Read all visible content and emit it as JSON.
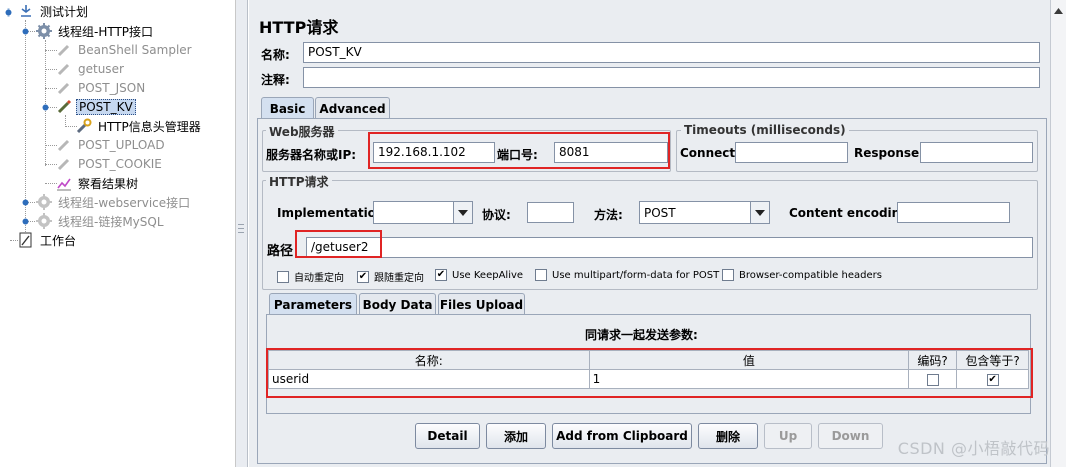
{
  "tree": {
    "test_plan": "测试计划",
    "thread_group_http": "线程组-HTTP接口",
    "beanshell": "BeanShell Sampler",
    "getuser": "getuser",
    "post_json": "POST_JSON",
    "post_kv": "POST_KV",
    "header_manager": "HTTP信息头管理器",
    "post_upload": "POST_UPLOAD",
    "post_cookie": "POST_COOKIE",
    "view_results": "察看结果树",
    "thread_group_ws": "线程组-webservice接口",
    "thread_group_mysql": "线程组-链接MySQL",
    "workbench": "工作台"
  },
  "panel": {
    "title": "HTTP请求",
    "name_label": "名称:",
    "name_value": "POST_KV",
    "comment_label": "注释:",
    "comment_value": ""
  },
  "tabs": {
    "basic": "Basic",
    "advanced": "Advanced"
  },
  "web_server": {
    "group_title": "Web服务器",
    "server_label": "服务器名称或IP:",
    "server_value": "192.168.1.102",
    "port_label": "端口号:",
    "port_value": "8081"
  },
  "timeouts": {
    "group_title": "Timeouts (milliseconds)",
    "connect_label": "Connect:",
    "connect_value": "",
    "response_label": "Response:",
    "response_value": ""
  },
  "http_request": {
    "group_title": "HTTP请求",
    "impl_label": "Implementation:",
    "impl_value": "",
    "protocol_label": "协议:",
    "protocol_value": "",
    "method_label": "方法:",
    "method_value": "POST",
    "encoding_label": "Content encoding:",
    "encoding_value": "",
    "path_label": "路径",
    "path_value": "/getuser2"
  },
  "options": {
    "auto_redirect": "自动重定向",
    "follow_redirect": "跟随重定向",
    "keepalive": "Use KeepAlive",
    "multipart": "Use multipart/form-data for POST",
    "browser_headers": "Browser-compatible headers",
    "checked": [
      "follow_redirect",
      "keepalive"
    ]
  },
  "sub_tabs": {
    "parameters": "Parameters",
    "body_data": "Body Data",
    "files_upload": "Files Upload"
  },
  "params": {
    "caption": "同请求一起发送参数:",
    "col_name": "名称:",
    "col_value": "值",
    "col_encode": "编码?",
    "col_include_equals": "包含等于?",
    "rows": [
      {
        "name": "userid",
        "value": "1",
        "encode": false,
        "include_equals": true
      }
    ]
  },
  "buttons": {
    "detail": "Detail",
    "add": "添加",
    "add_clipboard": "Add from Clipboard",
    "delete": "删除",
    "up": "Up",
    "down": "Down"
  },
  "watermark": "CSDN @小梧敲代码",
  "colors": {
    "highlight_box": "#e02424",
    "selection": "#c6d8f0",
    "panel_bg": "#eaedf1"
  },
  "icons": [
    "test-plan-icon",
    "thread-group-gear-icon",
    "sampler-pencil-icon",
    "header-manager-wrench-icon",
    "result-tree-chart-icon",
    "workbench-icon",
    "dropdown-arrow-icon"
  ]
}
